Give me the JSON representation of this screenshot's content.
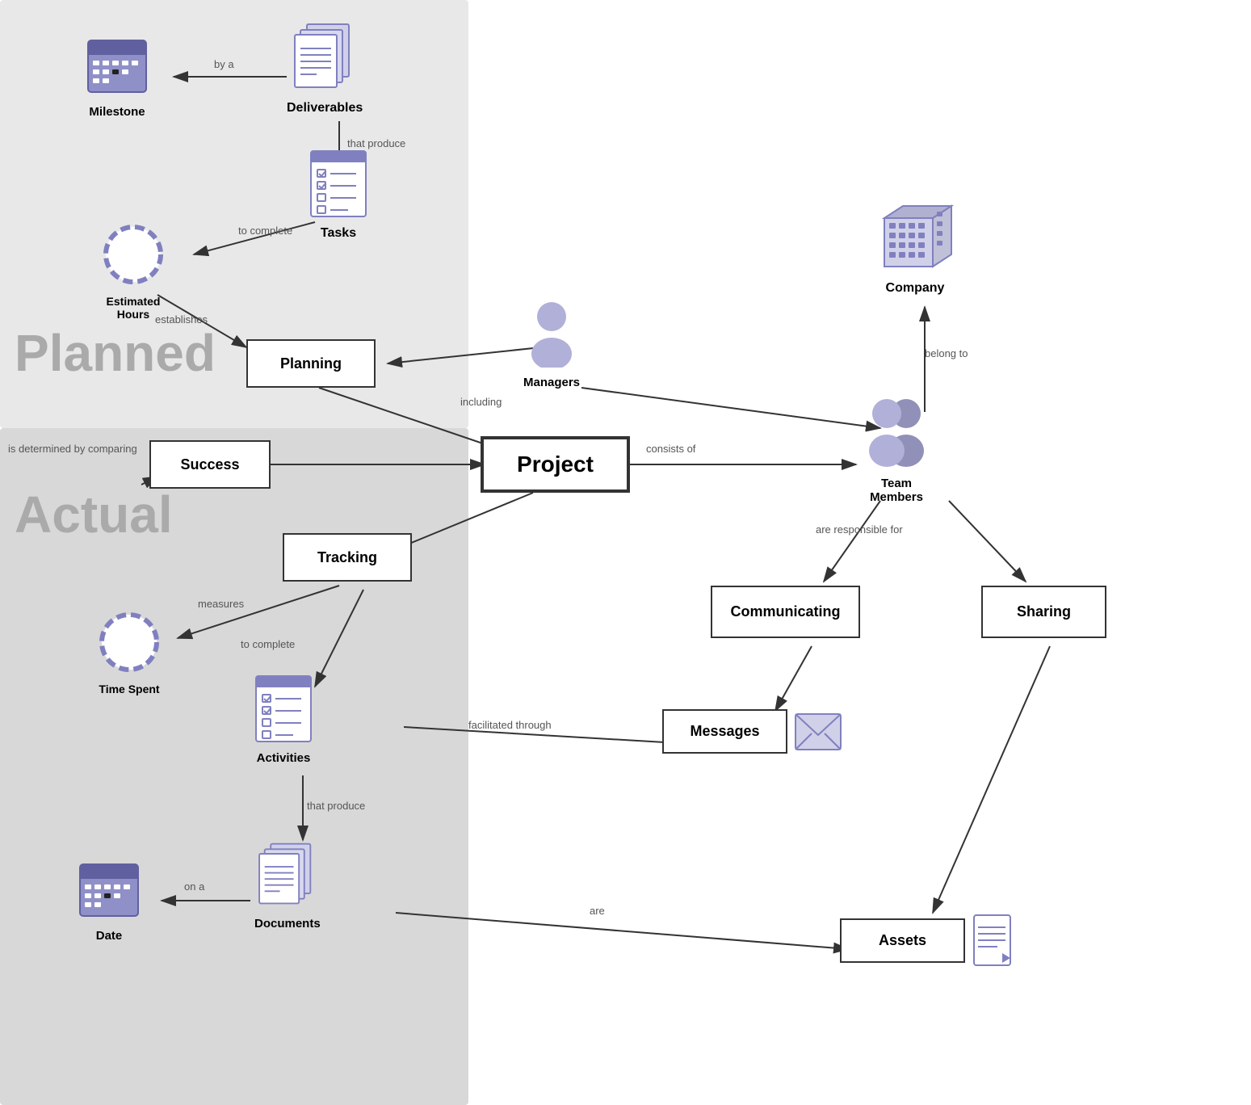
{
  "regions": {
    "planned_label": "Planned",
    "actual_label": "Actual"
  },
  "nodes": {
    "milestone": "Milestone",
    "deliverables": "Deliverables",
    "tasks": "Tasks",
    "estimated_hours": "Estimated Hours",
    "planning": "Planning",
    "success": "Success",
    "project": "Project",
    "tracking": "Tracking",
    "time_spent": "Time Spent",
    "activities": "Activities",
    "documents": "Documents",
    "date": "Date",
    "managers": "Managers",
    "company": "Company",
    "team_members": "Team Members",
    "communicating": "Communicating",
    "sharing": "Sharing",
    "messages": "Messages",
    "assets": "Assets"
  },
  "edge_labels": {
    "by_a": "by a",
    "that_produce_tasks": "that produce",
    "to_complete_tasks": "to complete",
    "establishes": "establishes",
    "is_determined_by": "is determined by\ncomparing",
    "consists_of": "consists of",
    "including": "including",
    "belong_to": "belong to",
    "are_responsible_for": "are responsible for",
    "measures": "measures",
    "to_complete_activities": "to complete",
    "facilitated_through": "facilitated through",
    "that_produce_docs": "that produce",
    "on_a": "on a",
    "are": "are"
  }
}
